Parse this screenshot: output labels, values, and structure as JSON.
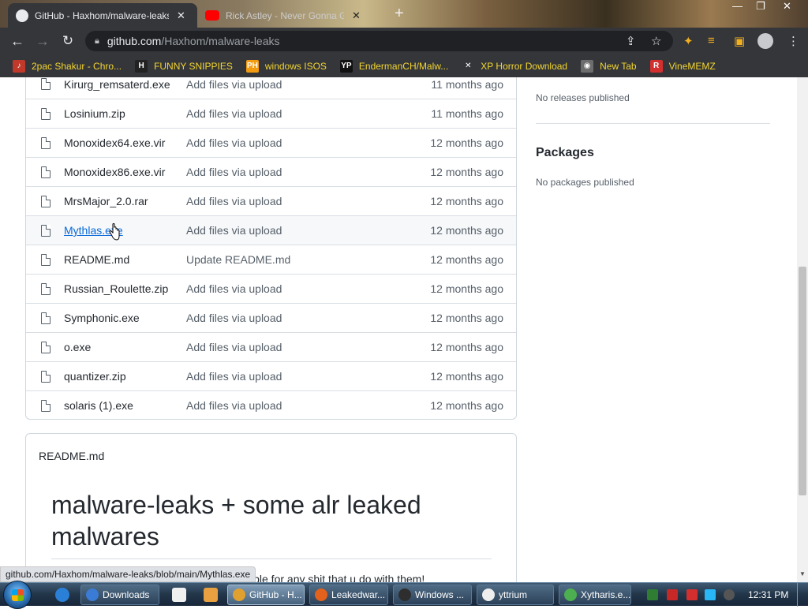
{
  "browser": {
    "tabs": [
      {
        "title": "GitHub - Haxhom/malware-leaks",
        "close": "✕",
        "active": true
      },
      {
        "title": "Rick Astley - Never Gonna Give You Up",
        "close": "✕",
        "active": false
      }
    ],
    "new_tab": "+",
    "window_controls": {
      "minimize": "—",
      "maximize": "❐",
      "close": "✕"
    },
    "address": {
      "host": "github.com",
      "path": "/Haxhom/malware-leaks"
    },
    "bookmarks": [
      {
        "label": "2pac Shakur - Chro...",
        "icon": "music-icon",
        "color": "#c0392b",
        "glyph": "♪"
      },
      {
        "label": "FUNNY SNIPPIES",
        "icon": "h-logo-icon",
        "color": "#222222",
        "glyph": "H"
      },
      {
        "label": "windows ISOS",
        "icon": "ph-logo-icon",
        "color": "#f39c12",
        "glyph": "PH"
      },
      {
        "label": "EndermanCH/Malw...",
        "icon": "yp-logo-icon",
        "color": "#111111",
        "glyph": "YP"
      },
      {
        "label": "XP Horror Download",
        "icon": "x-logo-icon",
        "color": "#35363a",
        "glyph": "✕"
      },
      {
        "label": "New Tab",
        "icon": "globe-icon",
        "color": "#6d6d6d",
        "glyph": "◉"
      },
      {
        "label": "VineMEMZ",
        "icon": "r-logo-icon",
        "color": "#d32f2f",
        "glyph": "R"
      }
    ]
  },
  "files": [
    {
      "name": "Kirurg_remsaterd.exe",
      "message": "Add files via upload",
      "age": "11 months ago"
    },
    {
      "name": "Losinium.zip",
      "message": "Add files via upload",
      "age": "11 months ago"
    },
    {
      "name": "Monoxidex64.exe.vir",
      "message": "Add files via upload",
      "age": "12 months ago"
    },
    {
      "name": "Monoxidex86.exe.vir",
      "message": "Add files via upload",
      "age": "12 months ago"
    },
    {
      "name": "MrsMajor_2.0.rar",
      "message": "Add files via upload",
      "age": "12 months ago"
    },
    {
      "name": "Mythlas.exe",
      "message": "Add files via upload",
      "age": "12 months ago",
      "hovered": true
    },
    {
      "name": "README.md",
      "message": "Update README.md",
      "age": "12 months ago"
    },
    {
      "name": "Russian_Roulette.zip",
      "message": "Add files via upload",
      "age": "12 months ago"
    },
    {
      "name": "Symphonic.exe",
      "message": "Add files via upload",
      "age": "12 months ago"
    },
    {
      "name": "o.exe",
      "message": "Add files via upload",
      "age": "12 months ago"
    },
    {
      "name": "quantizer.zip",
      "message": "Add files via upload",
      "age": "12 months ago"
    },
    {
      "name": "solaris (1).exe",
      "message": "Add files via upload",
      "age": "12 months ago"
    }
  ],
  "readme": {
    "label": "README.md",
    "title": "malware-leaks + some alr leaked malwares",
    "partial_text": "ible for any shit that u do with them!"
  },
  "sidebar": {
    "no_releases": "No releases published",
    "packages_heading": "Packages",
    "no_packages": "No packages published"
  },
  "status_url": "github.com/Haxhom/malware-leaks/blob/main/Mythlas.exe",
  "taskbar": {
    "items": [
      {
        "label": "Downloads",
        "icon": "explorer-icon",
        "color": "#3a7bd5"
      },
      {
        "label": "GitHub - H...",
        "icon": "chrome-icon",
        "color": "#e0a030",
        "active": true
      },
      {
        "label": "Leakedwar...",
        "icon": "firefox-icon",
        "color": "#e2611c"
      },
      {
        "label": "Windows ...",
        "icon": "terminal-icon",
        "color": "#2e2e2e"
      },
      {
        "label": "yttrium",
        "icon": "app-window-icon",
        "color": "#eeeeee"
      },
      {
        "label": "Xytharis.e...",
        "icon": "green-app-icon",
        "color": "#4caf50"
      }
    ],
    "clock": "12:31 PM"
  }
}
